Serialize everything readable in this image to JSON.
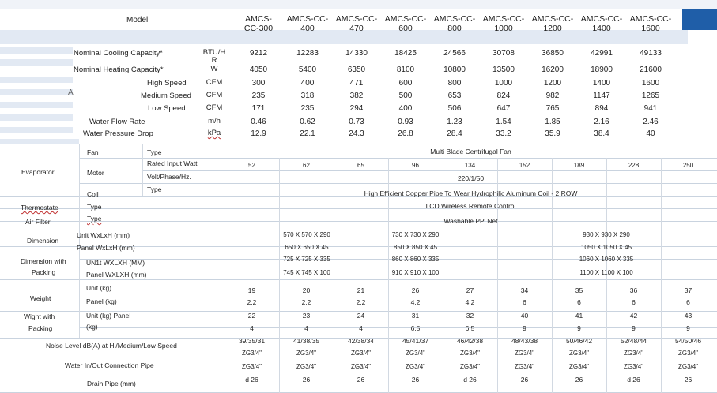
{
  "top_table": {
    "model_label": "Model",
    "models": [
      [
        "AMCS-",
        "CC-300"
      ],
      [
        "AMCS-CC-",
        "400"
      ],
      [
        "AMCS-CC-",
        "470"
      ],
      [
        "AMCS-CC-",
        "600"
      ],
      [
        "AMCS-CC-",
        "800"
      ],
      [
        "AMCS-CC-",
        "1000"
      ],
      [
        "AMCS-CC-",
        "1200"
      ],
      [
        "AMCS-CC-",
        "1400"
      ],
      [
        "AMCS-CC-",
        "1600"
      ]
    ],
    "rows": [
      {
        "label": "Nominal Cooling Capacity*",
        "unit": "BTU/H\nR",
        "values": [
          "9212",
          "12283",
          "14330",
          "18425",
          "24566",
          "30708",
          "36850",
          "42991",
          "49133"
        ]
      },
      {
        "label": "Nominal Heating Capacity*",
        "unit": "W",
        "values": [
          "4050",
          "5400",
          "6350",
          "8100",
          "10800",
          "13500",
          "16200",
          "18900",
          "21600"
        ]
      },
      {
        "label": "High Speed",
        "unit": "CFM",
        "values": [
          "300",
          "400",
          "471",
          "600",
          "800",
          "1000",
          "1200",
          "1400",
          "1600"
        ]
      },
      {
        "label": "Medium Speed",
        "unit": "CFM",
        "values": [
          "235",
          "318",
          "382",
          "500",
          "653",
          "824",
          "982",
          "1147",
          "1265"
        ]
      },
      {
        "label": "Low Speed",
        "unit": "CFM",
        "values": [
          "171",
          "235",
          "294",
          "400",
          "506",
          "647",
          "765",
          "894",
          "941"
        ]
      },
      {
        "label": "Water Flow Rate",
        "unit": "m/h",
        "values": [
          "0.46",
          "0.62",
          "0.73",
          "0.93",
          "1.23",
          "1.54",
          "1.85",
          "2.16",
          "2.46"
        ]
      },
      {
        "label": "Water Pressure Drop",
        "unit": "kPa",
        "values": [
          "12.9",
          "22.1",
          "24.3",
          "26.8",
          "28.4",
          "33.2",
          "35.9",
          "38.4",
          "40"
        ]
      }
    ],
    "side_mark": "A"
  },
  "bottom_table": {
    "evaporator": "Evaporator",
    "fan": "Fan",
    "fan_type": "Type",
    "fan_type_value": "Multi Blade Centrifugal Fan",
    "motor": "Motor",
    "rated_input": "Rated Input Watt",
    "rated_values": [
      "52",
      "62",
      "65",
      "96",
      "134",
      "152",
      "189",
      "228",
      "250"
    ],
    "volt": "Volt/Phase/Hz.",
    "volt_value": "220/1/50",
    "coil": "Coil",
    "coil_type": "Type",
    "coil_value": "High Efficient Copper Pipe To Wear Hydrophilic Aluminum Coil - 2 ROW",
    "thermostat": "Thermostate",
    "thermostat_type": "Type",
    "thermostat_value": "LCD Wireless Remote  Control",
    "air_filter": "Air Filter",
    "air_filter_type": "Type",
    "air_filter_value": "Washable PP. Net",
    "dimension": "Dimension",
    "dim_unit": "Unit WxLxH (mm)",
    "dim_panel": "Panel WxLxH (mm)",
    "dim_unit_values": [
      "570 X 570 X 290",
      "730 X 730 X 290",
      "930 X 930 X 290"
    ],
    "dim_panel_values": [
      "650 X 650 X 45",
      "850 X 850 X 45",
      "1050 X 1050 X 45"
    ],
    "dim_pack": "Dimension with",
    "dim_pack2": "Packing",
    "pack_unit": "UN1t WXLXH (MM)",
    "pack_panel": "Panel WXLXH  (mm)",
    "pack_unit_values": [
      "725 X 725 X 335",
      "860 X 860 X 335",
      "1060 X 1060 X 335"
    ],
    "pack_panel_values": [
      "745 X 745 X 100",
      "910 X 910 X 100",
      "1100 X 1100 X 100"
    ],
    "weight": "Weight",
    "w_unit": "Unit (kg)",
    "w_panel": "Panel (kg)",
    "w_unit_values": [
      "19",
      "20",
      "21",
      "26",
      "27",
      "34",
      "35",
      "36",
      "37"
    ],
    "w_panel_values": [
      "2.2",
      "2.2",
      "2.2",
      "4.2",
      "4.2",
      "6",
      "6",
      "6",
      "6"
    ],
    "wp_label1": "Wight with",
    "wp_label2": "Packing",
    "wp_unit": "Unit (kg) Panel",
    "wp_panel": "(kg)",
    "wp_unit_values": [
      "22",
      "23",
      "24",
      "31",
      "32",
      "40",
      "41",
      "42",
      "43"
    ],
    "wp_panel_values": [
      "4",
      "4",
      "4",
      "6.5",
      "6.5",
      "9",
      "9",
      "9",
      "9"
    ],
    "noise": "Noise  Level  dB(A)  at  Hi/Medium/Low  Speed",
    "noise_values": [
      "39/35/31",
      "41/38/35",
      "42/38/34",
      "45/41/37",
      "46/42/38",
      "48/43/38",
      "50/46/42",
      "52/48/44",
      "54/50/46"
    ],
    "water_pipe": "Water In/Out Connection Pipe",
    "water_pipe_values": [
      "ZG3/4\"",
      "ZG3/4\"",
      "ZG3/4\"",
      "ZG3/4\"",
      "ZG3/4\"",
      "ZG3/4\"",
      "ZG3/4\"",
      "ZG3/4\"",
      "ZG3/4\""
    ],
    "drain": "Drain Pipe (mm)",
    "drain_values": [
      "d 26",
      "26",
      "26",
      "26",
      "d 26",
      "26",
      "26",
      "d 26",
      "26"
    ]
  },
  "colors": {
    "band": "#e2e9f3",
    "accent": "#1f5ea8"
  }
}
